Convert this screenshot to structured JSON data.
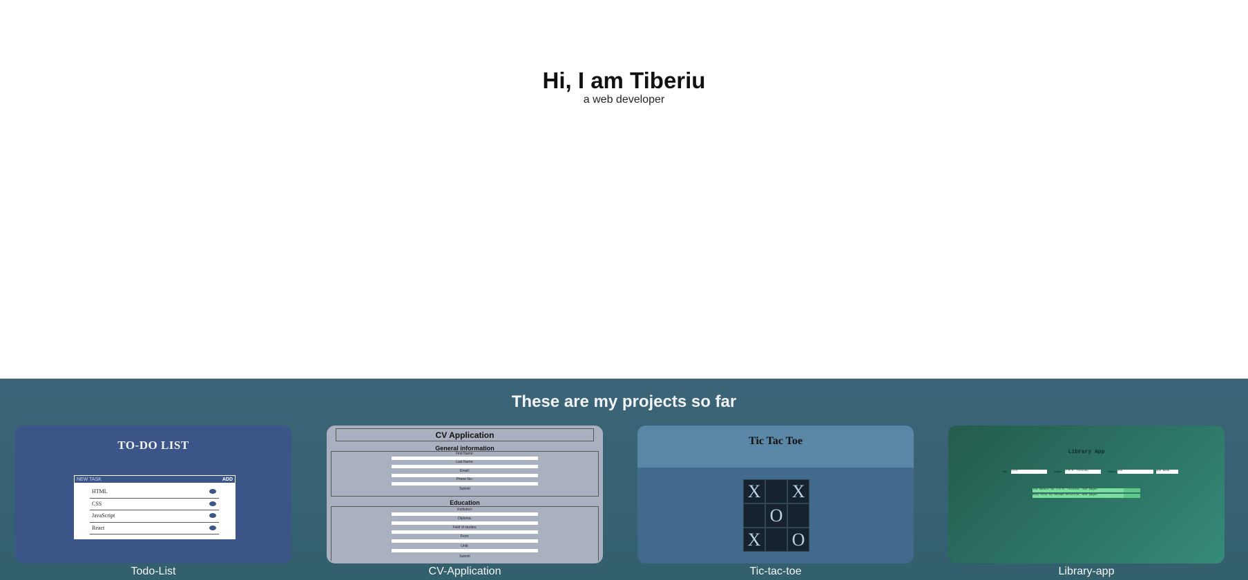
{
  "hero": {
    "title": "Hi, I am Tiberiu",
    "subtitle": "a web developer"
  },
  "projects": {
    "heading": "These are my projects so far",
    "cards": [
      {
        "label": "Todo-List"
      },
      {
        "label": "CV-Application"
      },
      {
        "label": "Tic-tac-toe"
      },
      {
        "label": "Library-app"
      }
    ]
  },
  "todo_preview": {
    "title": "TO-DO LIST",
    "input_placeholder": "NEW TASK",
    "add_label": "ADD",
    "items": [
      "HTML",
      "CSS",
      "JavaScript",
      "React"
    ]
  },
  "cv_preview": {
    "title": "CV Application",
    "general_heading": "General information",
    "general_fields": [
      "First Name:",
      "Last Name:",
      "Email:",
      "Phone No.:"
    ],
    "submit": "Submit",
    "education_heading": "Education",
    "education_fields": [
      "Institution:",
      "Diploma:",
      "Field of studies:",
      "From:",
      "Until:"
    ],
    "date_placeholder": "mm/dd/yyyy"
  },
  "ttt_preview": {
    "title": "Tic Tac Toe",
    "cells": [
      "X",
      "",
      "X",
      "",
      "O",
      "",
      "X",
      "",
      "O"
    ]
  },
  "lib_preview": {
    "title": "Library App",
    "inputs": [
      "Title",
      "Author",
      "Pages"
    ],
    "values": [
      "LOTR",
      "J.R.R. Tolkien",
      "400"
    ],
    "add_button": "ADD BOOK",
    "rows": [
      "The Hobbit by J.R.R. Tolkien, 295 pages",
      "Moby Dick by Herman Melville, 600 pages"
    ]
  },
  "colors": {
    "projects_bg": "#3c6478",
    "todo_bg": "#3b5589",
    "cv_bg": "#a9b0bf",
    "ttt_bg": "#426a8c",
    "lib_bg": "#2d7466"
  }
}
